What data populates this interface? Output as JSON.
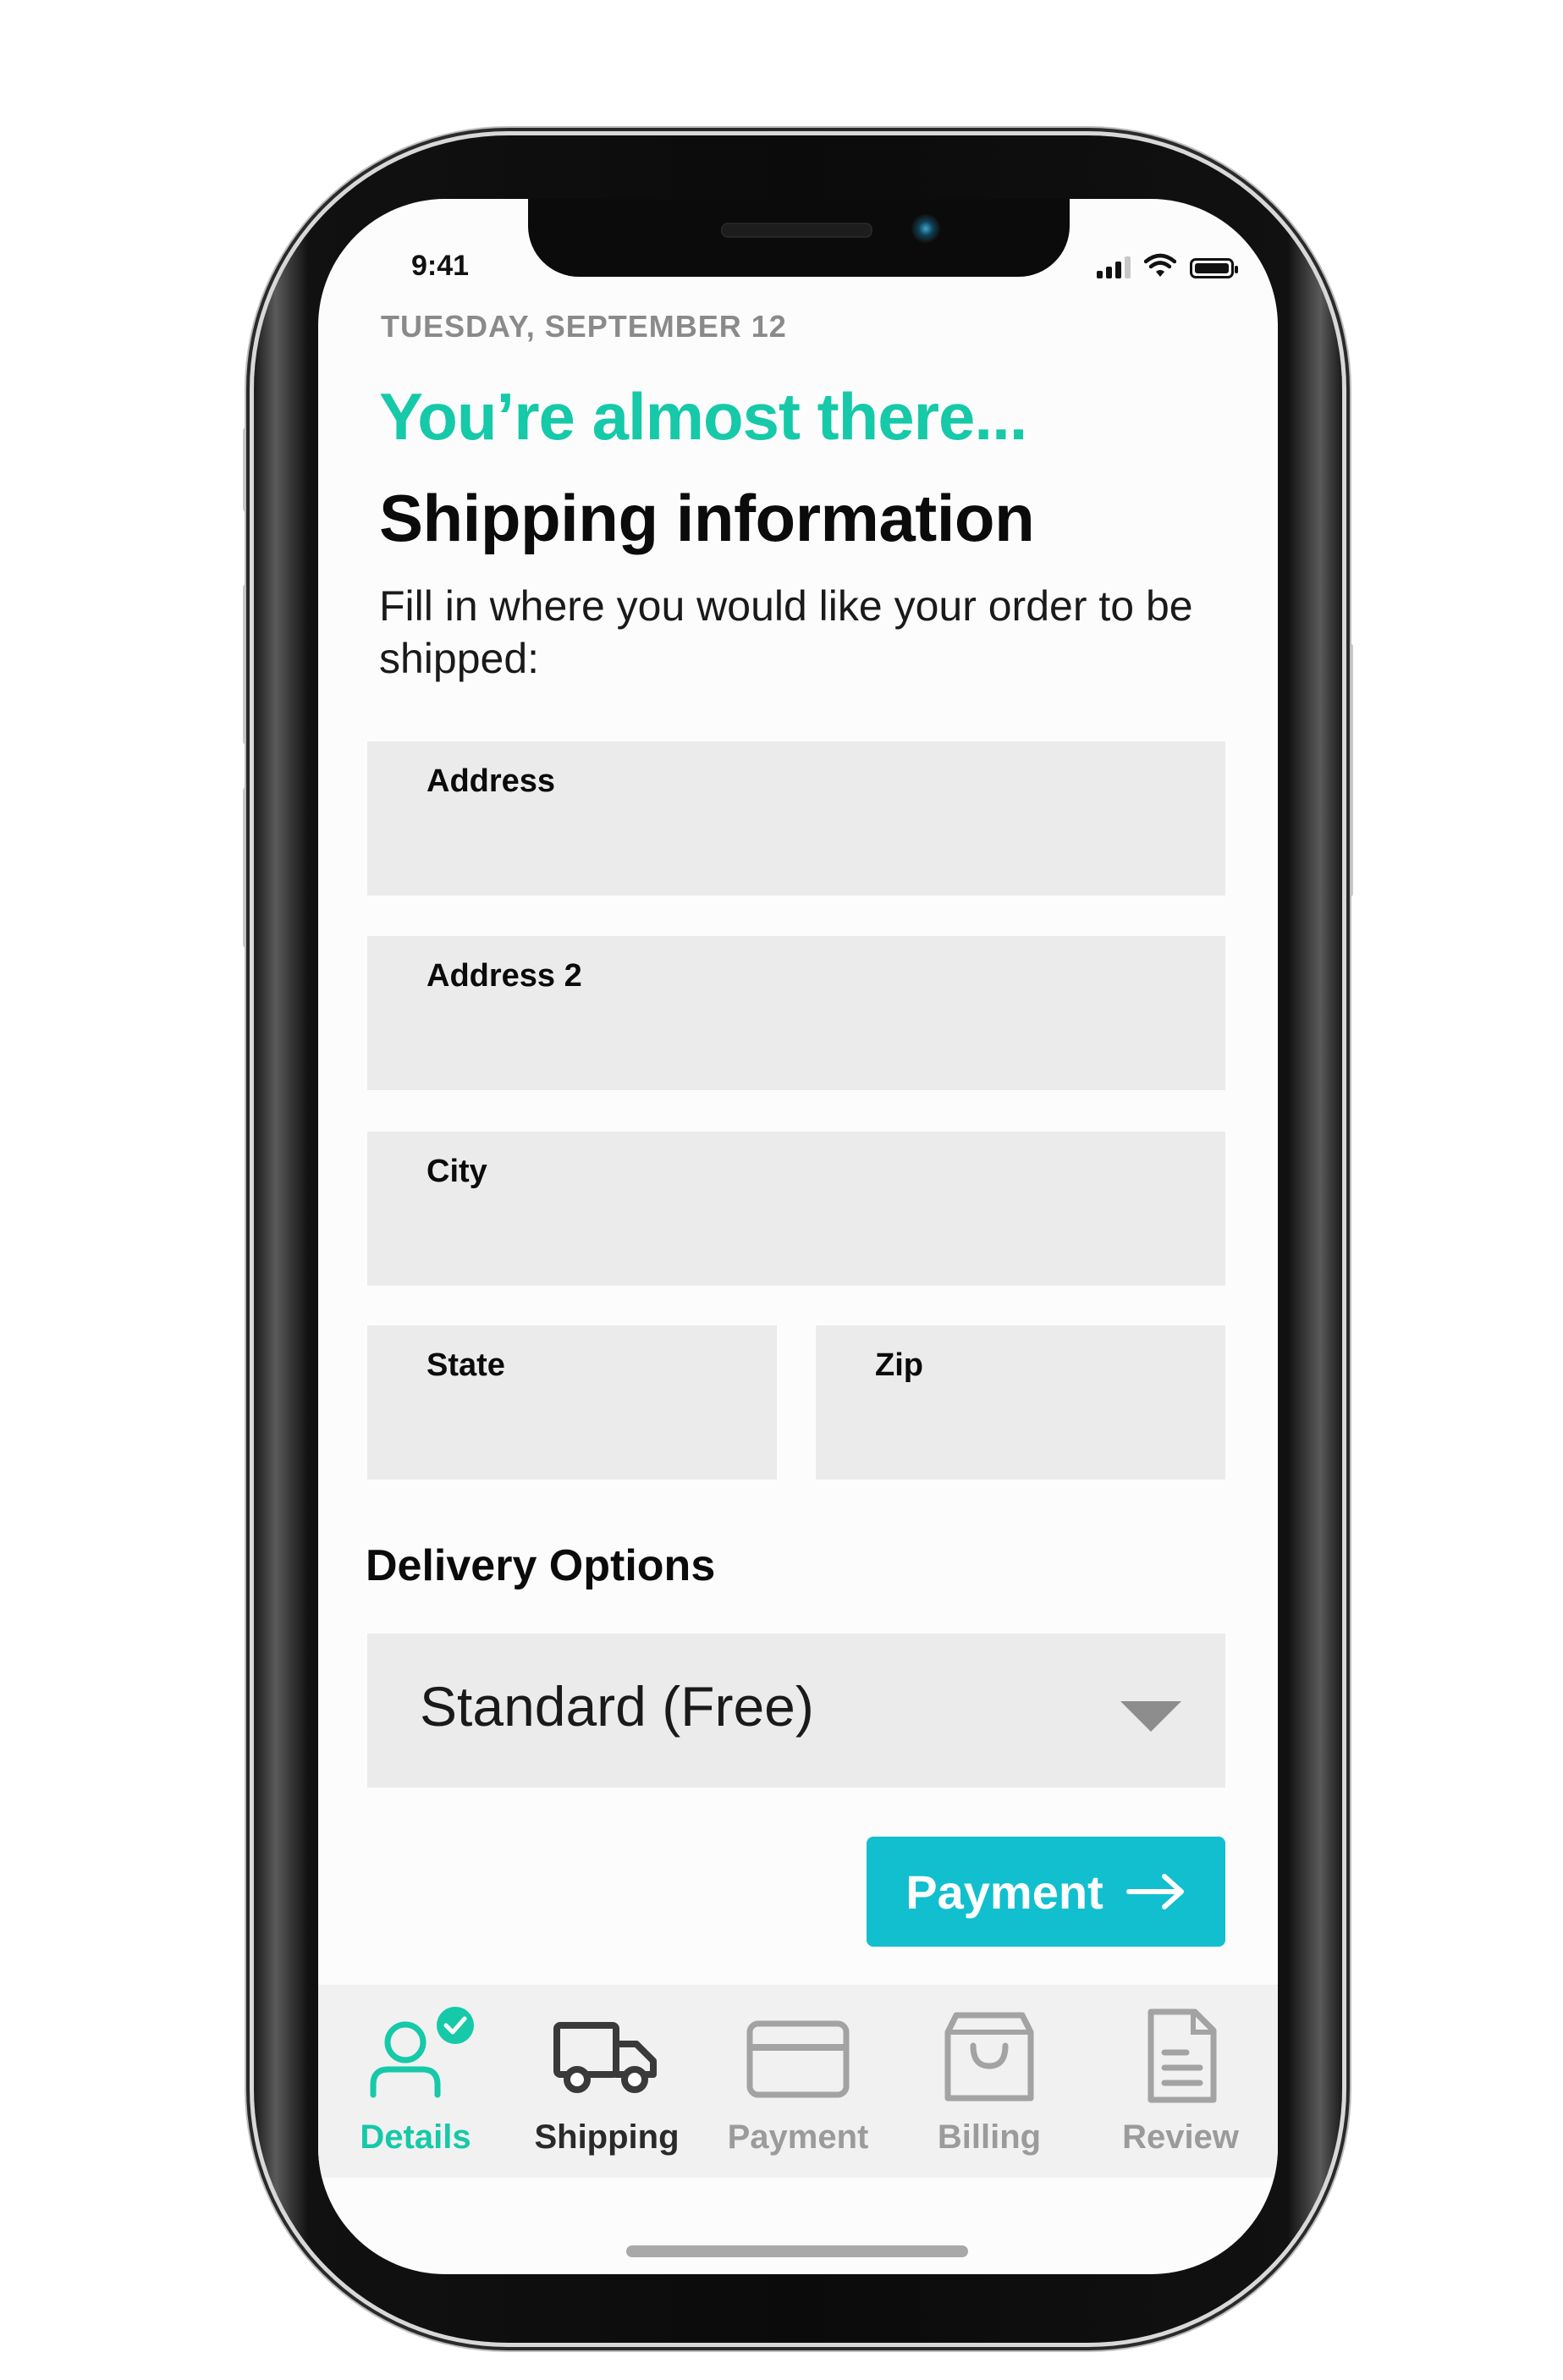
{
  "status_bar": {
    "time": "9:41"
  },
  "header": {
    "date": "TUESDAY, SEPTEMBER 12",
    "tagline": "You’re almost there...",
    "title": "Shipping information",
    "subtitle": "Fill in where you would like your order to be shipped:"
  },
  "form": {
    "address_label": "Address",
    "address_value": "",
    "address2_label": "Address 2",
    "address2_value": "",
    "city_label": "City",
    "city_value": "",
    "state_label": "State",
    "state_value": "",
    "zip_label": "Zip",
    "zip_value": ""
  },
  "delivery": {
    "heading": "Delivery Options",
    "selected": "Standard (Free)"
  },
  "actions": {
    "next_label": "Payment"
  },
  "tabs": [
    {
      "label": "Details",
      "icon": "person-icon",
      "state": "completed"
    },
    {
      "label": "Shipping",
      "icon": "truck-icon",
      "state": "current"
    },
    {
      "label": "Payment",
      "icon": "credit-card-icon",
      "state": "disabled"
    },
    {
      "label": "Billing",
      "icon": "shopping-bag-icon",
      "state": "disabled"
    },
    {
      "label": "Review",
      "icon": "document-icon",
      "state": "disabled"
    }
  ],
  "colors": {
    "accent_green": "#16c9a8",
    "button_teal": "#12bfcf",
    "field_bg": "#ebebeb",
    "disabled_gray": "#9b9b9b",
    "text_dark": "#0b0b0b"
  }
}
